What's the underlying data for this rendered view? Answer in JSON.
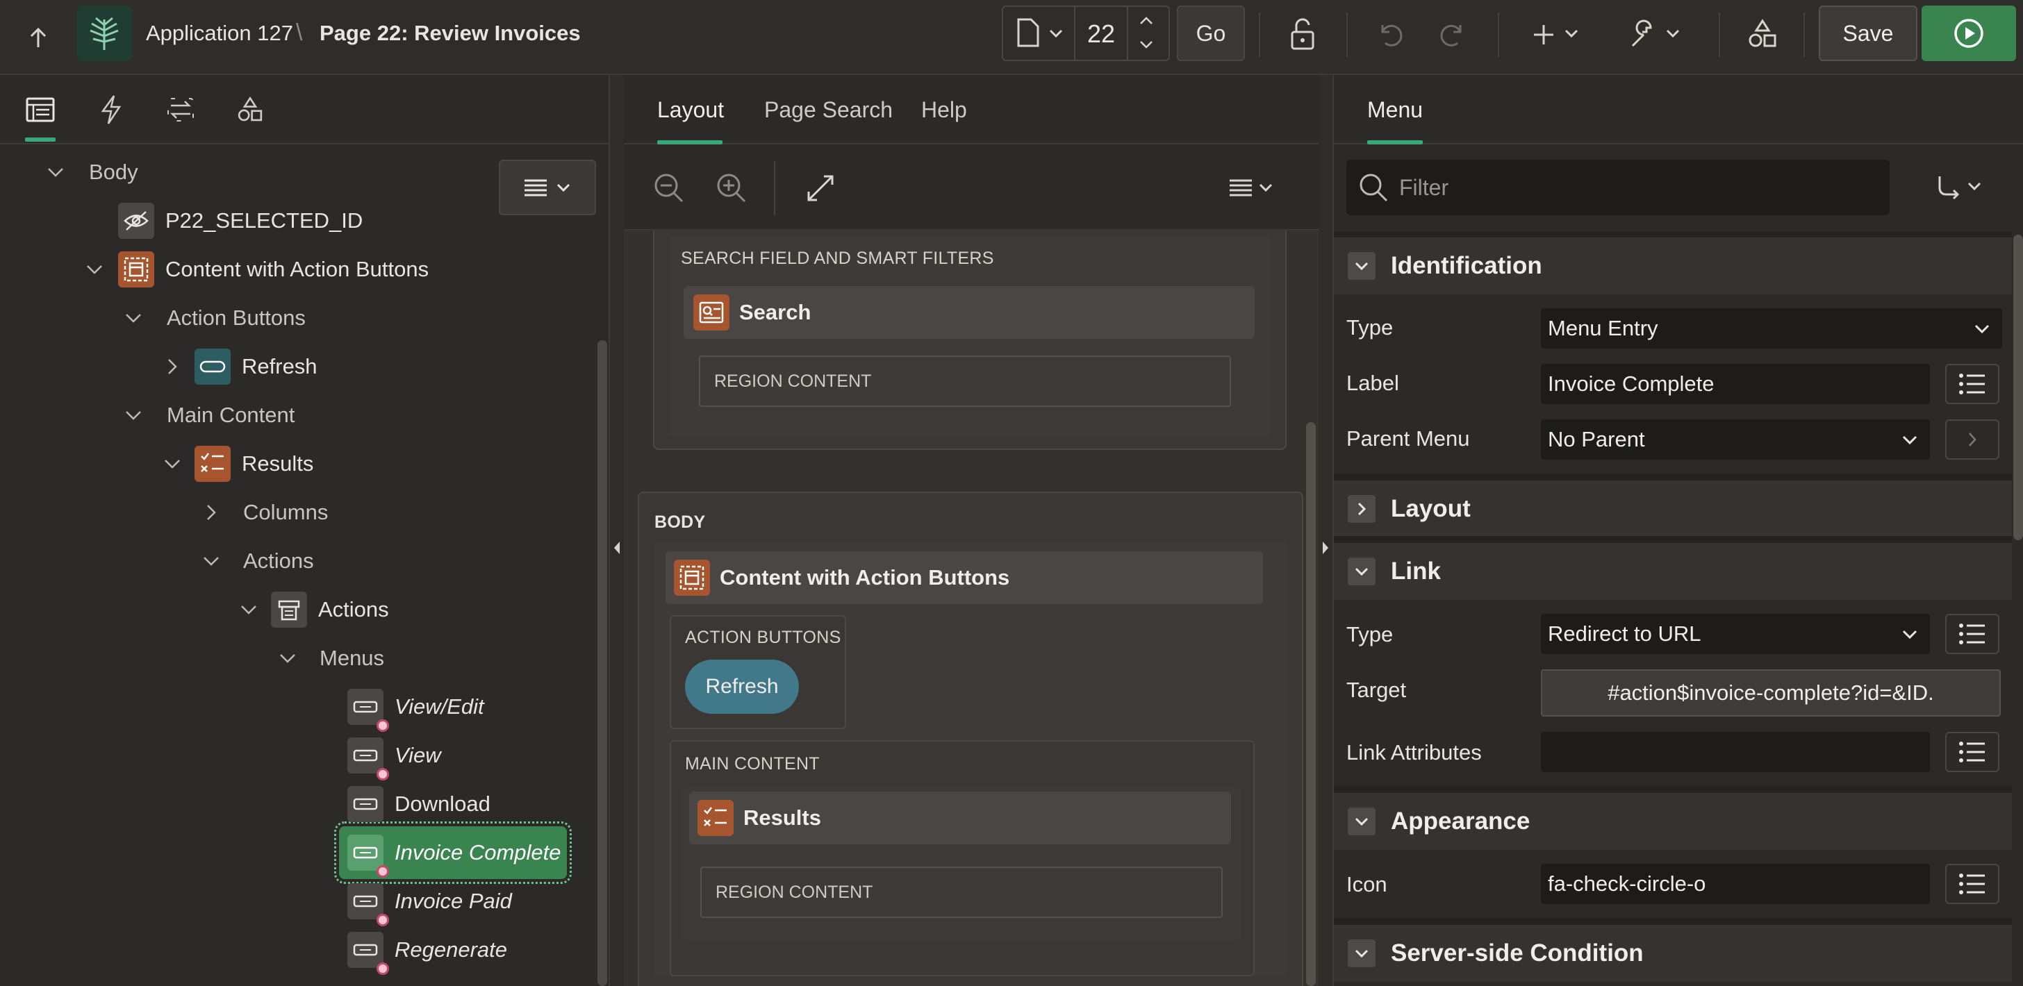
{
  "topbar": {
    "app_name": "Application 127",
    "breadcrumb_sep": "\\",
    "page_title": "Page 22: Review Invoices",
    "page_number": "22",
    "go_label": "Go",
    "save_label": "Save"
  },
  "left": {
    "tree": [
      {
        "label": "Body"
      },
      {
        "label": "P22_SELECTED_ID"
      },
      {
        "label": "Content with Action Buttons"
      },
      {
        "label": "Action Buttons"
      },
      {
        "label": "Refresh"
      },
      {
        "label": "Main Content"
      },
      {
        "label": "Results"
      },
      {
        "label": "Columns"
      },
      {
        "label": "Actions"
      },
      {
        "label": "Actions"
      },
      {
        "label": "Menus"
      },
      {
        "label": "View/Edit"
      },
      {
        "label": "View"
      },
      {
        "label": "Download"
      },
      {
        "label": "Invoice Complete"
      },
      {
        "label": "Invoice Paid"
      },
      {
        "label": "Regenerate"
      }
    ]
  },
  "middle": {
    "tabs": [
      {
        "label": "Layout"
      },
      {
        "label": "Page Search"
      },
      {
        "label": "Help"
      }
    ],
    "layout": {
      "top_region_caption": "SEARCH FIELD AND SMART FILTERS",
      "search_title": "Search",
      "region_content_1": "REGION CONTENT",
      "body_caption": "BODY",
      "content_title": "Content with Action Buttons",
      "action_buttons_caption": "ACTION BUTTONS",
      "refresh_button": "Refresh",
      "main_content_caption": "MAIN CONTENT",
      "results_title": "Results",
      "region_content_2": "REGION CONTENT"
    }
  },
  "right": {
    "tab": "Menu",
    "filter_placeholder": "Filter",
    "sections": {
      "identification": "Identification",
      "layout": "Layout",
      "link": "Link",
      "appearance": "Appearance",
      "server_side": "Server-side Condition"
    },
    "props": {
      "type_label": "Type",
      "type_value": "Menu Entry",
      "label_label": "Label",
      "label_value": "Invoice Complete",
      "parent_label": "Parent Menu",
      "parent_value": "No Parent",
      "link_type_label": "Type",
      "link_type_value": "Redirect to URL",
      "target_label": "Target",
      "target_value": "#action$invoice-complete?id=&ID.",
      "link_attr_label": "Link Attributes",
      "link_attr_value": "",
      "icon_label": "Icon",
      "icon_value": "fa-check-circle-o"
    }
  },
  "colors": {
    "accent_green": "#3a8450",
    "brand_brown": "#a7552f",
    "refresh_teal": "#41798a",
    "tab_underline": "#3aa87a"
  }
}
